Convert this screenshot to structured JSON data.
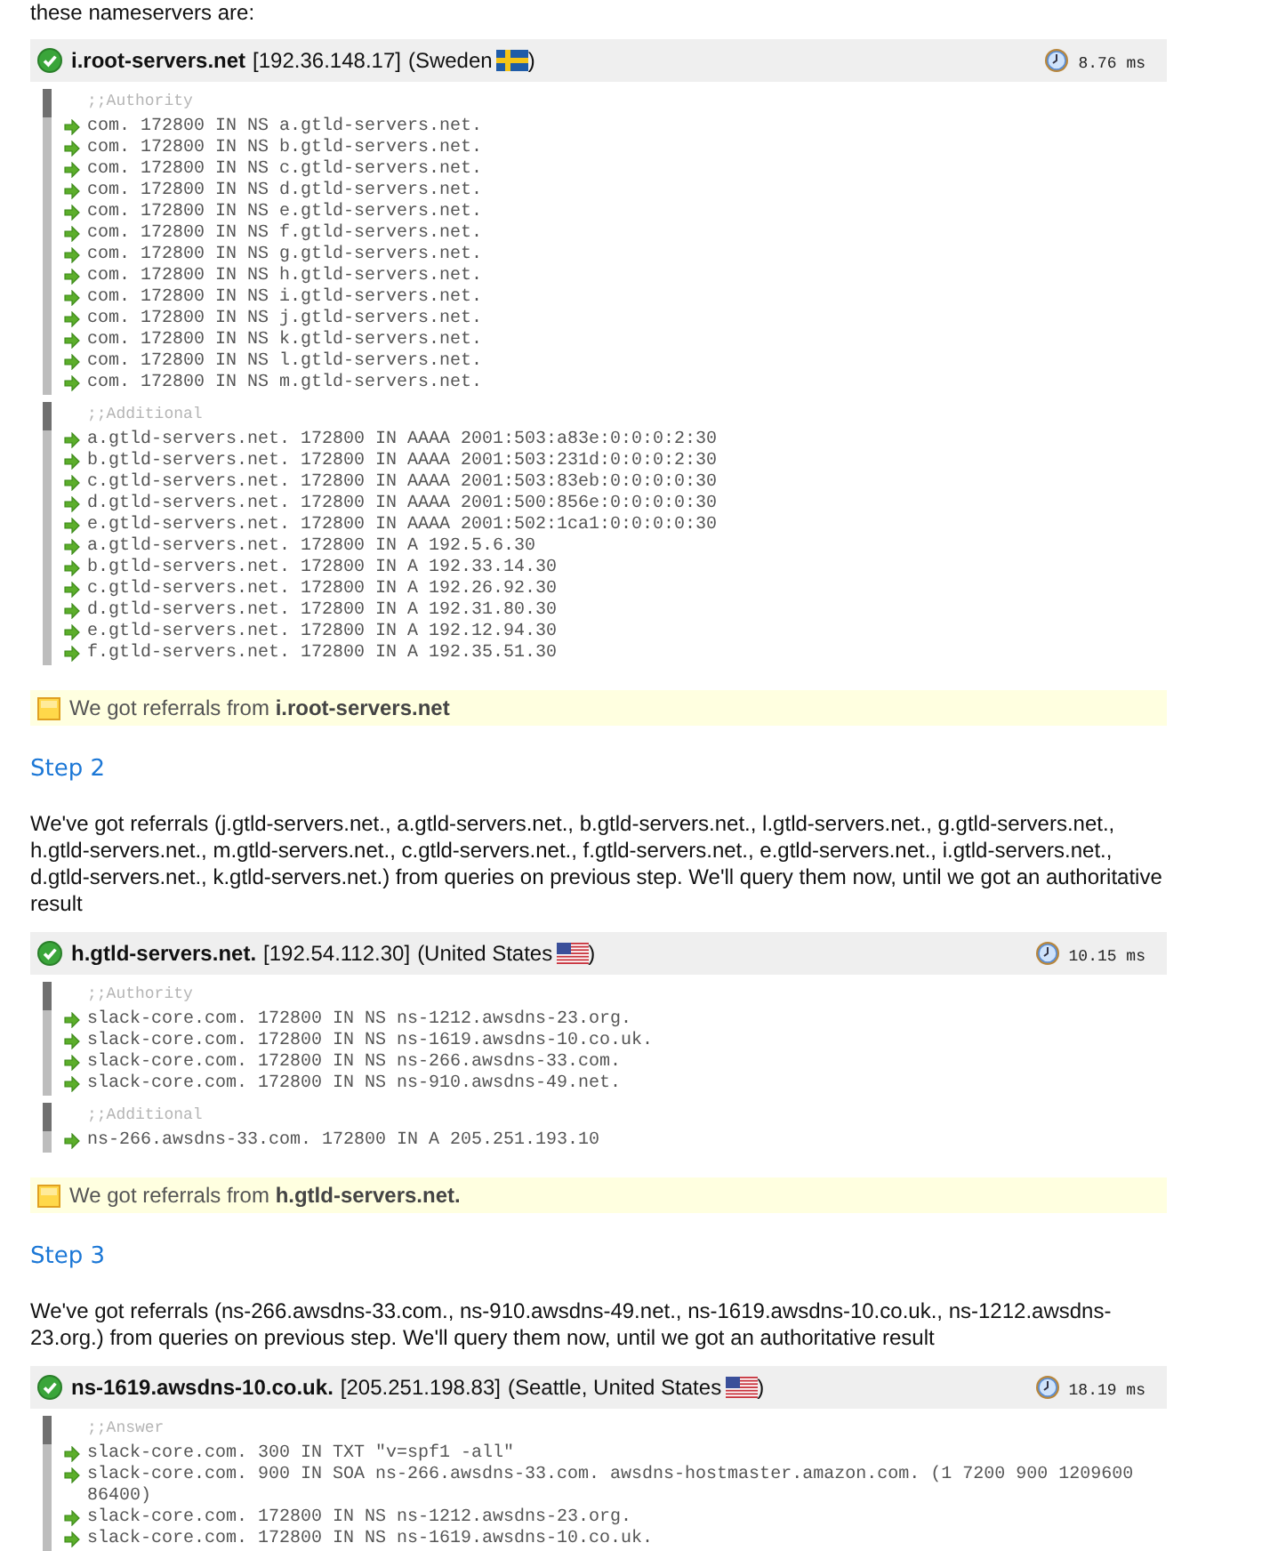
{
  "intro": "these nameservers are:",
  "blocks": [
    {
      "kind": "server",
      "name": "i.root-servers.net",
      "address": "[192.36.148.17]",
      "location": "(Sweden",
      "location_end": ")",
      "flag": {
        "kind": "sweden"
      },
      "time": "8.76 ms",
      "sections": [
        {
          "label": ";;Authority",
          "records": [
            "com. 172800 IN NS a.gtld-servers.net.",
            "com. 172800 IN NS b.gtld-servers.net.",
            "com. 172800 IN NS c.gtld-servers.net.",
            "com. 172800 IN NS d.gtld-servers.net.",
            "com. 172800 IN NS e.gtld-servers.net.",
            "com. 172800 IN NS f.gtld-servers.net.",
            "com. 172800 IN NS g.gtld-servers.net.",
            "com. 172800 IN NS h.gtld-servers.net.",
            "com. 172800 IN NS i.gtld-servers.net.",
            "com. 172800 IN NS j.gtld-servers.net.",
            "com. 172800 IN NS k.gtld-servers.net.",
            "com. 172800 IN NS l.gtld-servers.net.",
            "com. 172800 IN NS m.gtld-servers.net."
          ]
        },
        {
          "label": ";;Additional",
          "records": [
            "a.gtld-servers.net. 172800 IN AAAA 2001:503:a83e:0:0:0:2:30",
            "b.gtld-servers.net. 172800 IN AAAA 2001:503:231d:0:0:0:2:30",
            "c.gtld-servers.net. 172800 IN AAAA 2001:503:83eb:0:0:0:0:30",
            "d.gtld-servers.net. 172800 IN AAAA 2001:500:856e:0:0:0:0:30",
            "e.gtld-servers.net. 172800 IN AAAA 2001:502:1ca1:0:0:0:0:30",
            "a.gtld-servers.net. 172800 IN A 192.5.6.30",
            "b.gtld-servers.net. 172800 IN A 192.33.14.30",
            "c.gtld-servers.net. 172800 IN A 192.26.92.30",
            "d.gtld-servers.net. 172800 IN A 192.31.80.30",
            "e.gtld-servers.net. 172800 IN A 192.12.94.30",
            "f.gtld-servers.net. 172800 IN A 192.35.51.30"
          ]
        }
      ]
    },
    {
      "kind": "note",
      "text": "We got referrals from **i.root-servers.net**"
    },
    {
      "kind": "step",
      "title": "Step 2",
      "text": "We've got referrals (j.gtld-servers.net., a.gtld-servers.net., b.gtld-servers.net., l.gtld-servers.net., g.gtld-servers.net., h.gtld-servers.net., m.gtld-servers.net., c.gtld-servers.net., f.gtld-servers.net., e.gtld-servers.net., i.gtld-servers.net., d.gtld-servers.net., k.gtld-servers.net.) from queries on previous step. We'll query them now, until we got an authoritative result"
    },
    {
      "kind": "server",
      "name": "h.gtld-servers.net.",
      "address": "[192.54.112.30]",
      "location": "(United States",
      "location_end": ")",
      "flag": {
        "kind": "usa"
      },
      "time": "10.15 ms",
      "sections": [
        {
          "label": ";;Authority",
          "records": [
            "slack-core.com. 172800 IN NS ns-1212.awsdns-23.org.",
            "slack-core.com. 172800 IN NS ns-1619.awsdns-10.co.uk.",
            "slack-core.com. 172800 IN NS ns-266.awsdns-33.com.",
            "slack-core.com. 172800 IN NS ns-910.awsdns-49.net."
          ]
        },
        {
          "label": ";;Additional",
          "records": [
            "ns-266.awsdns-33.com. 172800 IN A 205.251.193.10"
          ]
        }
      ]
    },
    {
      "kind": "note",
      "text": "We got referrals from **h.gtld-servers.net.**"
    },
    {
      "kind": "step",
      "title": "Step 3",
      "text": "We've got referrals (ns-266.awsdns-33.com., ns-910.awsdns-49.net., ns-1619.awsdns-10.co.uk., ns-1212.awsdns-23.org.) from queries on previous step. We'll query them now, until we got an authoritative result"
    },
    {
      "kind": "server",
      "name": "ns-1619.awsdns-10.co.uk.",
      "address": "[205.251.198.83]",
      "location": "(Seattle, United States",
      "location_end": ")",
      "flag": {
        "kind": "usa"
      },
      "time": "18.19 ms",
      "sections": [
        {
          "label": ";;Answer",
          "records": [
            "slack-core.com. 300 IN TXT \"v=spf1 -all\"",
            "slack-core.com. 900 IN SOA ns-266.awsdns-33.com. awsdns-hostmaster.amazon.com. (1 7200 900 1209600 86400)",
            "slack-core.com. 172800 IN NS ns-1212.awsdns-23.org.",
            "slack-core.com. 172800 IN NS ns-1619.awsdns-10.co.uk."
          ]
        }
      ]
    }
  ]
}
